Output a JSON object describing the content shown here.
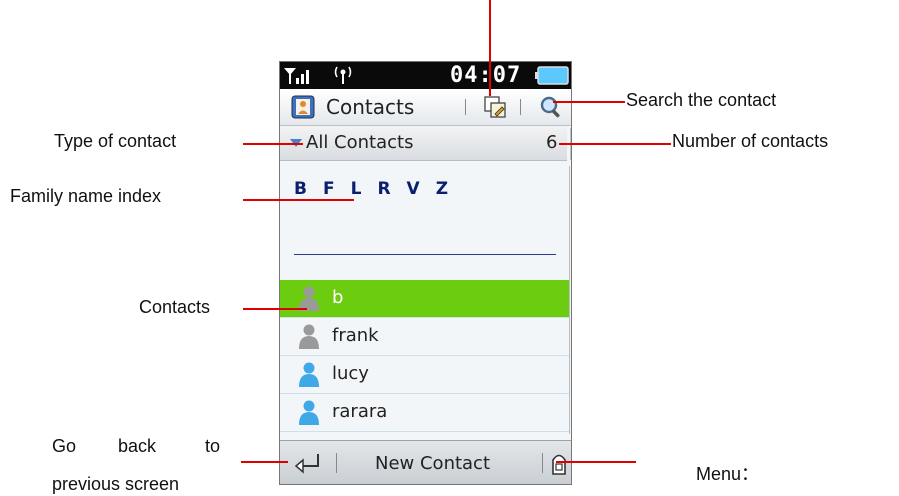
{
  "status": {
    "time": "04:07"
  },
  "titlebar": {
    "title": "Contacts"
  },
  "filter": {
    "label": "All Contacts",
    "count": "6"
  },
  "index_letters": [
    "B",
    "F",
    "L",
    "R",
    "V",
    "Z"
  ],
  "contacts": [
    {
      "name": "b",
      "selected": true,
      "avatar": "gray-person-icon"
    },
    {
      "name": "frank",
      "selected": false,
      "avatar": "gray-person-icon"
    },
    {
      "name": "lucy",
      "selected": false,
      "avatar": "blue-person-icon"
    },
    {
      "name": "rarara",
      "selected": false,
      "avatar": "blue-person-icon"
    }
  ],
  "softkeys": {
    "center": "New Contact"
  },
  "callouts": {
    "search": "Search the contact",
    "type": "Type of contact",
    "number": "Number of contacts",
    "family": "Family name index",
    "contacts": "Contacts",
    "back_line1": "Go",
    "back_line1b": "back",
    "back_line1c": "to",
    "back_line2": "previous screen",
    "menu": "Menu："
  },
  "colors": {
    "selected_row": "#6ccc10",
    "callout_line": "#e00000",
    "index_text": "#0b1f6e"
  }
}
